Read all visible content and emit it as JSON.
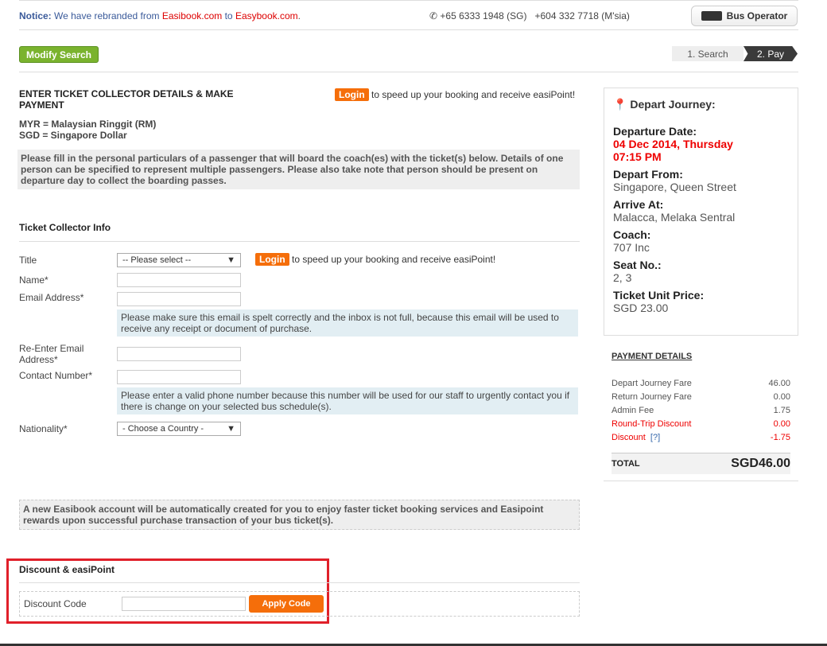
{
  "header": {
    "notice_label": "Notice:",
    "notice_text1": "We have rebranded from",
    "old_brand": "Easibook.com",
    "notice_to": "to",
    "new_brand": "Easybook.com",
    "notice_end": ".",
    "phone_sg": "+65 6333 1948 (SG)",
    "phone_my": "+604 332 7718 (M'sia)",
    "bus_operator": "Bus Operator"
  },
  "nav": {
    "modify_search": "Modify Search",
    "steps": [
      "1. Search",
      "2. Pay"
    ]
  },
  "main": {
    "title": "ENTER TICKET COLLECTOR DETAILS & MAKE PAYMENT",
    "login": "Login",
    "login_hint": "to speed up your booking and receive easiPoint!",
    "currency1": "MYR = Malaysian Ringgit (RM)",
    "currency2": "SGD = Singapore Dollar",
    "instructions": "Please fill in the personal particulars of a passenger that will board the coach(es) with the ticket(s) below. Details of one person can be specified to represent multiple passengers. Please also take note that person should be present on departure day to collect the boarding passes."
  },
  "form": {
    "section": "Ticket Collector Info",
    "title_label": "Title",
    "title_value": "-- Please select --",
    "name_label": "Name*",
    "email_label": "Email Address*",
    "email_note": "Please make sure this email is spelt correctly and the inbox is not full, because this email will be used to receive any receipt or document of purchase.",
    "reemail_label": "Re-Enter Email Address*",
    "contact_label": "Contact Number*",
    "contact_note": "Please enter a valid phone number because this number will be used for our staff to urgently contact you if there is change on your selected bus schedule(s).",
    "nationality_label": "Nationality*",
    "nationality_value": "- Choose a Country -",
    "account_note": "A new Easibook account will be automatically created for you to enjoy faster ticket booking services and Easipoint rewards upon successful purchase transaction of your bus ticket(s)."
  },
  "discount": {
    "section": "Discount & easiPoint",
    "code_label": "Discount Code",
    "code_value": "",
    "apply": "Apply Code"
  },
  "journey": {
    "title": "Depart Journey:",
    "date_label": "Departure Date:",
    "date": "04 Dec 2014, Thursday",
    "time": "07:15 PM",
    "from_label": "Depart From:",
    "from": "Singapore, Queen Street",
    "to_label": "Arrive At:",
    "to": "Malacca, Melaka Sentral",
    "coach_label": "Coach:",
    "coach": "707 Inc",
    "seat_label": "Seat No.:",
    "seat": "2, 3",
    "price_label": "Ticket Unit Price:",
    "price": "SGD 23.00"
  },
  "payment": {
    "title": "PAYMENT DETAILS",
    "rows": [
      {
        "label": "Depart Journey Fare",
        "value": "46.00"
      },
      {
        "label": "Return Journey Fare",
        "value": "0.00"
      },
      {
        "label": "Admin Fee",
        "value": "1.75"
      },
      {
        "label": "Round-Trip Discount",
        "value": "0.00"
      },
      {
        "label": "Discount",
        "help": "[?]",
        "value": "-1.75"
      }
    ],
    "total_label": "TOTAL",
    "total": "SGD46.00"
  }
}
